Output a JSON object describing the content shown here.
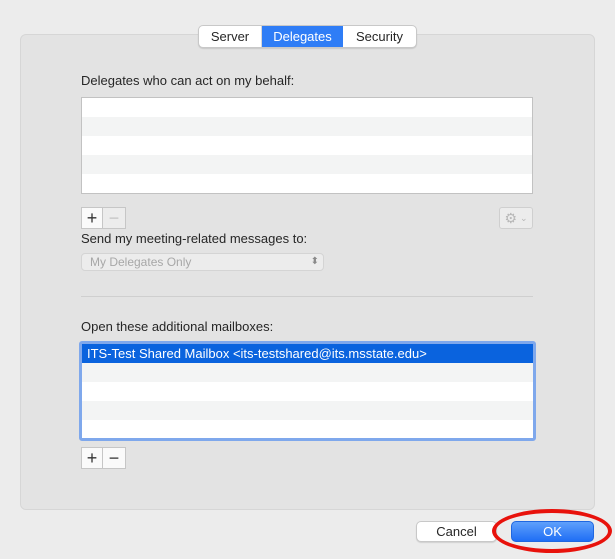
{
  "tabs": [
    {
      "label": "Server",
      "selected": false
    },
    {
      "label": "Delegates",
      "selected": true
    },
    {
      "label": "Security",
      "selected": false
    }
  ],
  "delegates": {
    "label": "Delegates who can act on my behalf:",
    "rows": [
      "",
      "",
      "",
      "",
      ""
    ],
    "add_label": "+",
    "remove_label": "−",
    "gear_icon": "gear-icon",
    "gear_chevron": "⌄"
  },
  "meeting": {
    "label": "Send my meeting-related messages to:",
    "selected_value": "My Delegates Only",
    "updown_glyph": "⬍"
  },
  "mailboxes": {
    "label": "Open these additional mailboxes:",
    "rows": [
      "ITS-Test Shared Mailbox <its-testshared@its.msstate.edu>",
      "",
      "",
      "",
      ""
    ],
    "selected_index": 0,
    "add_label": "+",
    "remove_label": "−"
  },
  "footer": {
    "cancel_label": "Cancel",
    "ok_label": "OK"
  },
  "colors": {
    "accent": "#2f7df6",
    "selection": "#0a63de",
    "annotation": "#e8120c"
  }
}
